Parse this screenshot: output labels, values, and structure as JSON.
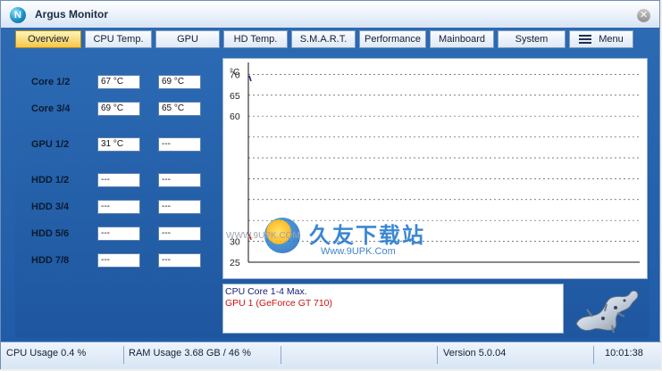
{
  "window": {
    "title": "Argus Monitor",
    "close_glyph": "✕",
    "app_icon_glyph": "N"
  },
  "tabs": [
    {
      "label": "Overview",
      "active": true
    },
    {
      "label": "CPU Temp.",
      "active": false
    },
    {
      "label": "GPU",
      "active": false
    },
    {
      "label": "HD Temp.",
      "active": false
    },
    {
      "label": "S.M.A.R.T.",
      "active": false
    },
    {
      "label": "Performance",
      "active": false
    },
    {
      "label": "Mainboard",
      "active": false
    },
    {
      "label": "System",
      "active": false
    },
    {
      "label": "Menu",
      "active": false
    }
  ],
  "sensors": [
    {
      "label": "Core 1/2",
      "v1": "67 °C",
      "v2": "69 °C"
    },
    {
      "label": "Core 3/4",
      "v1": "69 °C",
      "v2": "65 °C"
    },
    {
      "label": "GPU 1/2",
      "v1": "31 °C",
      "v2": "---"
    },
    {
      "label": "HDD 1/2",
      "v1": "---",
      "v2": "---"
    },
    {
      "label": "HDD 3/4",
      "v1": "---",
      "v2": "---"
    },
    {
      "label": "HDD 5/6",
      "v1": "---",
      "v2": "---"
    },
    {
      "label": "HDD 7/8",
      "v1": "---",
      "v2": "---"
    }
  ],
  "chart_data": {
    "type": "line",
    "ylabel": "°C",
    "y_ticks": [
      70,
      65,
      60,
      55,
      50,
      45,
      40,
      35,
      30,
      25
    ],
    "y_tick_labels_shown": [
      "70",
      "65",
      "60",
      "30",
      "25"
    ],
    "ylim": [
      25,
      72
    ],
    "grid": true,
    "series": [
      {
        "name": "CPU Core 1-4 Max.",
        "color": "#1a1a8c",
        "values": [
          69
        ]
      },
      {
        "name": "GPU 1 (GeForce GT 710)",
        "color": "#cc1111",
        "values": [
          31
        ]
      }
    ]
  },
  "legend": [
    {
      "text": "CPU Core 1-4 Max.",
      "color": "#14207a"
    },
    {
      "text": "GPU 1 (GeForce GT 710)",
      "color": "#cc1111"
    }
  ],
  "watermark": {
    "cn_text": "久友下载站",
    "url_left": "WWW.9UPK.COM",
    "url_right": "Www.9UPK.Com"
  },
  "status": {
    "cpu_usage": "CPU Usage 0.4 %",
    "ram_usage": "RAM Usage 3.68 GB / 46 %",
    "version": "Version 5.0.04",
    "time": "10:01:38"
  }
}
